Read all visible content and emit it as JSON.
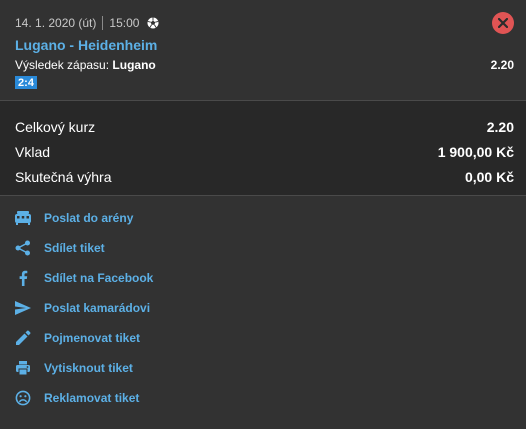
{
  "bet": {
    "date": "14. 1. 2020 (út)",
    "time": "15:00",
    "sport_icon": "soccer-ball-icon",
    "match": "Lugano - Heidenheim",
    "market_label": "Výsledek zápasu:",
    "selection": "Lugano",
    "odd": "2.20",
    "score": "2:4"
  },
  "summary": {
    "total_odds_label": "Celkový kurz",
    "total_odds_value": "2.20",
    "stake_label": "Vklad",
    "stake_value": "1 900,00 Kč",
    "win_label": "Skutečná výhra",
    "win_value": "0,00 Kč"
  },
  "actions": [
    {
      "icon": "arena-icon",
      "label": "Poslat do arény"
    },
    {
      "icon": "share-icon",
      "label": "Sdílet tiket"
    },
    {
      "icon": "facebook-icon",
      "label": "Sdílet na Facebook"
    },
    {
      "icon": "send-icon",
      "label": "Poslat kamarádovi"
    },
    {
      "icon": "pencil-icon",
      "label": "Pojmenovat tiket"
    },
    {
      "icon": "printer-icon",
      "label": "Vytisknout tiket"
    },
    {
      "icon": "sad-face-icon",
      "label": "Reklamovat tiket"
    }
  ],
  "colors": {
    "accent": "#5cb0e6",
    "badge": "#2a8ad9",
    "close": "#e05454",
    "background": "#323232",
    "summary_background": "#282828"
  }
}
